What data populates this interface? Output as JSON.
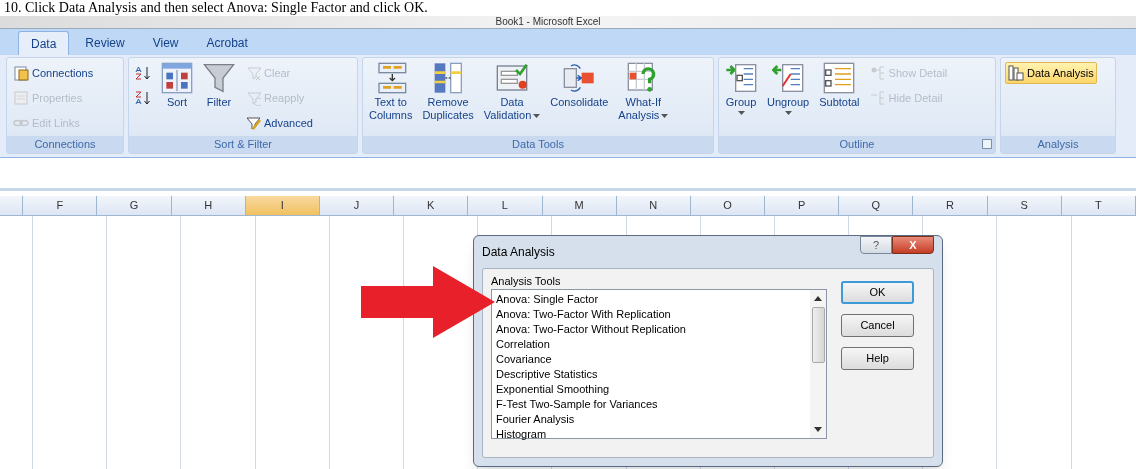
{
  "caption": "10. Click Data Analysis and then select Anova: Single Factor and click OK.",
  "window": {
    "title": "Book1 - Microsoft Excel"
  },
  "tabs": [
    {
      "label": "Data",
      "selected": true
    },
    {
      "label": "Review",
      "selected": false
    },
    {
      "label": "View",
      "selected": false
    },
    {
      "label": "Acrobat",
      "selected": false
    }
  ],
  "ribbon_groups": [
    {
      "label": "Connections",
      "launcher": false,
      "commands": [
        {
          "kind": "small",
          "label": "Connections",
          "disabled": false
        },
        {
          "kind": "small",
          "label": "Properties",
          "disabled": true
        },
        {
          "kind": "small",
          "label": "Edit Links",
          "disabled": true
        }
      ]
    },
    {
      "label": "Sort & Filter",
      "launcher": false,
      "commands": [
        {
          "kind": "icon",
          "disabled": false
        },
        {
          "kind": "icon",
          "disabled": false
        },
        {
          "kind": "large",
          "label": "Sort",
          "disabled": false
        },
        {
          "kind": "large",
          "label": "Filter",
          "disabled": false
        },
        {
          "kind": "small",
          "label": "Clear",
          "disabled": true
        },
        {
          "kind": "small",
          "label": "Reapply",
          "disabled": true
        },
        {
          "kind": "small",
          "label": "Advanced",
          "disabled": false
        }
      ]
    },
    {
      "label": "Data Tools",
      "launcher": false,
      "commands": [
        {
          "kind": "large",
          "label": "Text to\nColumns",
          "dropdown": false,
          "disabled": false
        },
        {
          "kind": "large",
          "label": "Remove\nDuplicates",
          "dropdown": false,
          "disabled": false
        },
        {
          "kind": "large",
          "label": "Data\nValidation",
          "dropdown": true,
          "disabled": false
        },
        {
          "kind": "large",
          "label": "Consolidate",
          "dropdown": false,
          "disabled": false
        },
        {
          "kind": "large",
          "label": "What-If\nAnalysis",
          "dropdown": true,
          "disabled": false
        }
      ]
    },
    {
      "label": "Outline",
      "launcher": true,
      "commands": [
        {
          "kind": "large",
          "label": "Group",
          "dropdown_below": true,
          "disabled": false
        },
        {
          "kind": "large",
          "label": "Ungroup",
          "dropdown_below": true,
          "disabled": false
        },
        {
          "kind": "large",
          "label": "Subtotal",
          "dropdown_below": false,
          "disabled": false
        },
        {
          "kind": "small",
          "label": "Show Detail",
          "disabled": true
        },
        {
          "kind": "small",
          "label": "Hide Detail",
          "disabled": true
        }
      ]
    },
    {
      "label": "Analysis",
      "launcher": false,
      "commands": [
        {
          "kind": "small",
          "label": "Data Analysis",
          "disabled": false,
          "highlighted": true
        }
      ]
    }
  ],
  "columns": [
    {
      "label": "F",
      "selected": false
    },
    {
      "label": "G",
      "selected": false
    },
    {
      "label": "H",
      "selected": false
    },
    {
      "label": "I",
      "selected": true
    },
    {
      "label": "J",
      "selected": false
    },
    {
      "label": "K",
      "selected": false
    },
    {
      "label": "L",
      "selected": false
    },
    {
      "label": "M",
      "selected": false
    },
    {
      "label": "N",
      "selected": false
    },
    {
      "label": "O",
      "selected": false
    },
    {
      "label": "P",
      "selected": false
    },
    {
      "label": "Q",
      "selected": false
    },
    {
      "label": "R",
      "selected": false
    },
    {
      "label": "S",
      "selected": false
    },
    {
      "label": "T",
      "selected": false
    }
  ],
  "dialog": {
    "title": "Data Analysis",
    "help_glyph": "?",
    "close_glyph": "X",
    "list_label": "Analysis Tools",
    "tools": [
      "Anova: Single Factor",
      "Anova: Two-Factor With Replication",
      "Anova: Two-Factor Without Replication",
      "Correlation",
      "Covariance",
      "Descriptive Statistics",
      "Exponential Smoothing",
      "F-Test Two-Sample for Variances",
      "Fourier Analysis",
      "Histogram"
    ],
    "buttons": [
      {
        "label": "OK",
        "default": true
      },
      {
        "label": "Cancel",
        "default": false
      },
      {
        "label": "Help",
        "default": false
      }
    ]
  }
}
